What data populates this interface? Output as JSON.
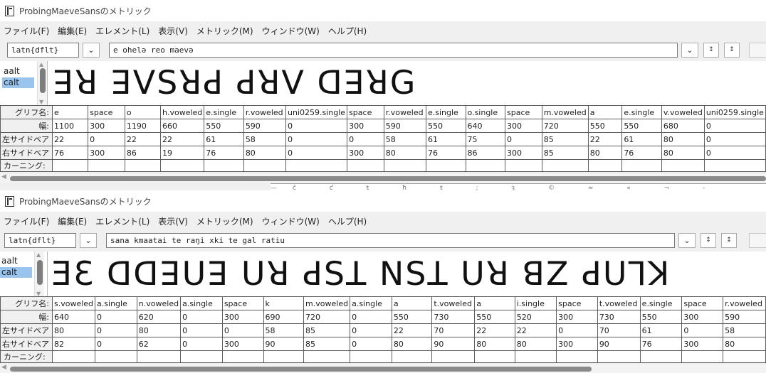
{
  "windows": [
    {
      "title": "ProbingMaeveSansのメトリック",
      "menu": [
        "ファイル(F)",
        "編集(E)",
        "エレメント(L)",
        "表示(V)",
        "メトリック(M)",
        "ウィンドウ(W)",
        "ヘルプ(H)"
      ],
      "feature": "latn{dflt}",
      "text": "e ohelə reo maevə",
      "lookups": [
        "aalt",
        "calt"
      ],
      "selected_lookup": "calt",
      "glyph_preview": "ꓱꓤ ꓱꓦꓢꓤꓒ ꓒꓤꓦ ꓷꓱꓤꓖ",
      "row_labels": {
        "glyph": "グリフ名:",
        "width": "幅:",
        "lsb": "左サイドベア",
        "rsb": "右サイドベア",
        "kern": "カーニング:"
      },
      "columns": [
        {
          "glyph": "e",
          "width": "1100",
          "lsb": "22",
          "rsb": "76"
        },
        {
          "glyph": "space",
          "width": "300",
          "lsb": "0",
          "rsb": "300"
        },
        {
          "glyph": "o",
          "width": "1190",
          "lsb": "22",
          "rsb": "86"
        },
        {
          "glyph": "h.voweled",
          "width": "660",
          "lsb": "22",
          "rsb": "19"
        },
        {
          "glyph": "e.single",
          "width": "550",
          "lsb": "61",
          "rsb": "76"
        },
        {
          "glyph": "r.voweled",
          "width": "590",
          "lsb": "58",
          "rsb": "80"
        },
        {
          "glyph": "uni0259.single",
          "width": "0",
          "lsb": "0",
          "rsb": "0"
        },
        {
          "glyph": "space",
          "width": "300",
          "lsb": "0",
          "rsb": "300"
        },
        {
          "glyph": "r.voweled",
          "width": "590",
          "lsb": "58",
          "rsb": "80"
        },
        {
          "glyph": "e.single",
          "width": "550",
          "lsb": "61",
          "rsb": "76"
        },
        {
          "glyph": "o.single",
          "width": "640",
          "lsb": "75",
          "rsb": "86"
        },
        {
          "glyph": "space",
          "width": "300",
          "lsb": "0",
          "rsb": "300"
        },
        {
          "glyph": "m.voweled",
          "width": "720",
          "lsb": "85",
          "rsb": "85"
        },
        {
          "glyph": "a",
          "width": "550",
          "lsb": "22",
          "rsb": "80"
        },
        {
          "glyph": "e.single",
          "width": "550",
          "lsb": "61",
          "rsb": "76"
        },
        {
          "glyph": "v.voweled",
          "width": "680",
          "lsb": "80",
          "rsb": "80"
        },
        {
          "glyph": "uni0259.single",
          "width": "0",
          "lsb": "0",
          "rsb": "0"
        }
      ]
    },
    {
      "title": "ProbingMaeveSansのメトリック",
      "menu": [
        "ファイル(F)",
        "編集(E)",
        "エレメント(L)",
        "表示(V)",
        "メトリック(M)",
        "ウィンドウ(W)",
        "ヘルプ(H)"
      ],
      "feature": "latn{dflt}",
      "text": "sana kmaatai te raŋi xki te gal ratiu",
      "lookups": [
        "aalt",
        "calt"
      ],
      "selected_lookup": "calt",
      "glyph_preview": "ƎƐ ꓷꓷꓱꓴꓱ ꓴꓤ ꓒꓢꓕ ꓠꓢꓕ ꓴꓤ ꓭꓜ ꓒꓴꓶꓘ",
      "row_labels": {
        "glyph": "グリフ名:",
        "width": "幅:",
        "lsb": "左サイドベア",
        "rsb": "右サイドベア",
        "kern": "カーニング:"
      },
      "columns": [
        {
          "glyph": "s.voweled",
          "width": "640",
          "lsb": "80",
          "rsb": "82"
        },
        {
          "glyph": "a.single",
          "width": "0",
          "lsb": "0",
          "rsb": "0"
        },
        {
          "glyph": "n.voweled",
          "width": "620",
          "lsb": "80",
          "rsb": "62"
        },
        {
          "glyph": "a.single",
          "width": "0",
          "lsb": "0",
          "rsb": "0"
        },
        {
          "glyph": "space",
          "width": "300",
          "lsb": "0",
          "rsb": "300"
        },
        {
          "glyph": "k",
          "width": "690",
          "lsb": "58",
          "rsb": "90"
        },
        {
          "glyph": "m.voweled",
          "width": "720",
          "lsb": "85",
          "rsb": "85"
        },
        {
          "glyph": "a.single",
          "width": "0",
          "lsb": "0",
          "rsb": "0"
        },
        {
          "glyph": "a",
          "width": "550",
          "lsb": "22",
          "rsb": "80"
        },
        {
          "glyph": "t.voweled",
          "width": "730",
          "lsb": "70",
          "rsb": "90"
        },
        {
          "glyph": "a",
          "width": "550",
          "lsb": "22",
          "rsb": "80"
        },
        {
          "glyph": "i.single",
          "width": "520",
          "lsb": "22",
          "rsb": "80"
        },
        {
          "glyph": "space",
          "width": "300",
          "lsb": "0",
          "rsb": "300"
        },
        {
          "glyph": "t.voweled",
          "width": "730",
          "lsb": "70",
          "rsb": "90"
        },
        {
          "glyph": "e.single",
          "width": "550",
          "lsb": "61",
          "rsb": "76"
        },
        {
          "glyph": "space",
          "width": "300",
          "lsb": "0",
          "rsb": "300"
        },
        {
          "glyph": "r.voweled",
          "width": "590",
          "lsb": "58",
          "rsb": "80"
        }
      ]
    }
  ],
  "icons": {
    "app": "metrics-window-icon",
    "dropdown": "chevron-down-icon",
    "vertical_kerning_buttons": "vertical-arrows-icon"
  },
  "colors": {
    "selection": "#99c4ee",
    "scrollbar_thumb": "#8a8a8a"
  }
}
